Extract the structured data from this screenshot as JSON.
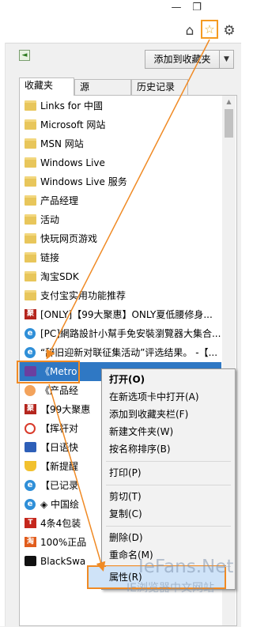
{
  "window": {
    "minimize_icon": "minimize-icon",
    "restore_icon": "restore-icon"
  },
  "commandbar": {
    "home_icon": "home-icon",
    "favorites_icon": "star-icon",
    "tools_icon": "gear-icon"
  },
  "favorites_pane": {
    "add_button": "添加到收藏夹",
    "tabs": [
      {
        "label": "收藏夹"
      },
      {
        "label": "源"
      },
      {
        "label": "历史记录"
      }
    ],
    "items": [
      {
        "label": "Links for 中國",
        "icon": "folder"
      },
      {
        "label": "Microsoft 网站",
        "icon": "folder"
      },
      {
        "label": "MSN 网站",
        "icon": "folder"
      },
      {
        "label": "Windows Live",
        "icon": "folder"
      },
      {
        "label": "Windows Live 服务",
        "icon": "folder"
      },
      {
        "label": "产品经理",
        "icon": "folder"
      },
      {
        "label": "活动",
        "icon": "folder"
      },
      {
        "label": "快玩网页游戏",
        "icon": "folder"
      },
      {
        "label": "链接",
        "icon": "folder"
      },
      {
        "label": "淘宝SDK",
        "icon": "folder"
      },
      {
        "label": "支付宝实用功能推荐",
        "icon": "folder"
      },
      {
        "label": "[ONLY]【99大聚惠】ONLY夏低腰修身...",
        "icon": "red"
      },
      {
        "label": "[PC]網路設計小幫手免安裝瀏覽器大集合...",
        "icon": "ie"
      },
      {
        "label": "“辞旧迎新对联征集活动”评选结果。 -【...",
        "icon": "ie"
      },
      {
        "label": "《Metro",
        "icon": "metro"
      },
      {
        "label": "《产品经",
        "icon": "smile"
      },
      {
        "label": "【99大聚惠",
        "icon": "red"
      },
      {
        "label": "【挥杆对",
        "icon": "play"
      },
      {
        "label": "【日语快",
        "icon": "paw"
      },
      {
        "label": "【新提醒",
        "icon": "trophy"
      },
      {
        "label": "【已记录",
        "icon": "ie"
      },
      {
        "label": "◈ 中国绘",
        "icon": "ie"
      },
      {
        "label": "4条4包装",
        "icon": "t"
      },
      {
        "label": "100%正品",
        "icon": "tao"
      },
      {
        "label": "BlackSwa",
        "icon": "swan"
      }
    ]
  },
  "context_menu": {
    "items": [
      {
        "label": "打开(O)",
        "bold": true
      },
      {
        "label": "在新选项卡中打开(A)"
      },
      {
        "label": "添加到收藏夹栏(F)"
      },
      {
        "label": "新建文件夹(W)"
      },
      {
        "label": "按名称排序(B)"
      },
      {
        "label": "打印(P)"
      },
      {
        "label": "剪切(T)"
      },
      {
        "label": "复制(C)"
      },
      {
        "label": "删除(D)"
      },
      {
        "label": "重命名(M)"
      },
      {
        "label": "属性(R)"
      }
    ]
  },
  "watermark": {
    "line1": "IeFans.Net",
    "line2": "IE浏览器中文网站"
  },
  "colors": {
    "highlight_orange": "#f08a24",
    "selection_blue": "#2f78c4",
    "folder_yellow": "#e8c65b"
  }
}
